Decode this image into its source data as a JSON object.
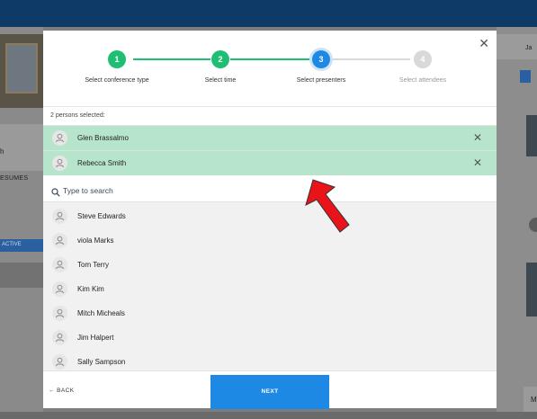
{
  "background": {
    "left_text_fragment": "h",
    "left_resumes_fragment": "ESUMES",
    "left_active_fragment": "ACTIVE",
    "right_header_fragment": "Ja",
    "right_bottom_fragment": "M"
  },
  "stepper": {
    "steps": [
      {
        "number": "1",
        "label": "Select conference type",
        "state": "done"
      },
      {
        "number": "2",
        "label": "Select time",
        "state": "done"
      },
      {
        "number": "3",
        "label": "Select presenters",
        "state": "active"
      },
      {
        "number": "4",
        "label": "Select attendees",
        "state": "pending"
      }
    ]
  },
  "selection": {
    "count_text": "2 persons selected:",
    "selected": [
      {
        "name": "Glen Brassalmo"
      },
      {
        "name": "Rebecca Smith"
      }
    ]
  },
  "search": {
    "placeholder": "Type to search",
    "value": ""
  },
  "people": [
    {
      "name": "Steve Edwards"
    },
    {
      "name": "viola Marks"
    },
    {
      "name": "Tom Terry"
    },
    {
      "name": "Kim Kim"
    },
    {
      "name": "Mitch Micheals"
    },
    {
      "name": "Jim Halpert"
    },
    {
      "name": "Sally Sampson"
    }
  ],
  "footer": {
    "back_label": "BACK",
    "next_label": "NEXT"
  },
  "icons": {
    "close": "close-icon",
    "remove": "close-icon",
    "avatar": "person-icon",
    "search": "search-icon",
    "back": "arrow-left-icon",
    "annotation": "red-arrow-annotation"
  },
  "colors": {
    "done": "#1fbf73",
    "active": "#1e88e5",
    "pending": "#d9d9d9",
    "selected_row": "#b7e5cc",
    "topbar": "#0d3a66",
    "annotation_arrow": "#e8141a"
  }
}
